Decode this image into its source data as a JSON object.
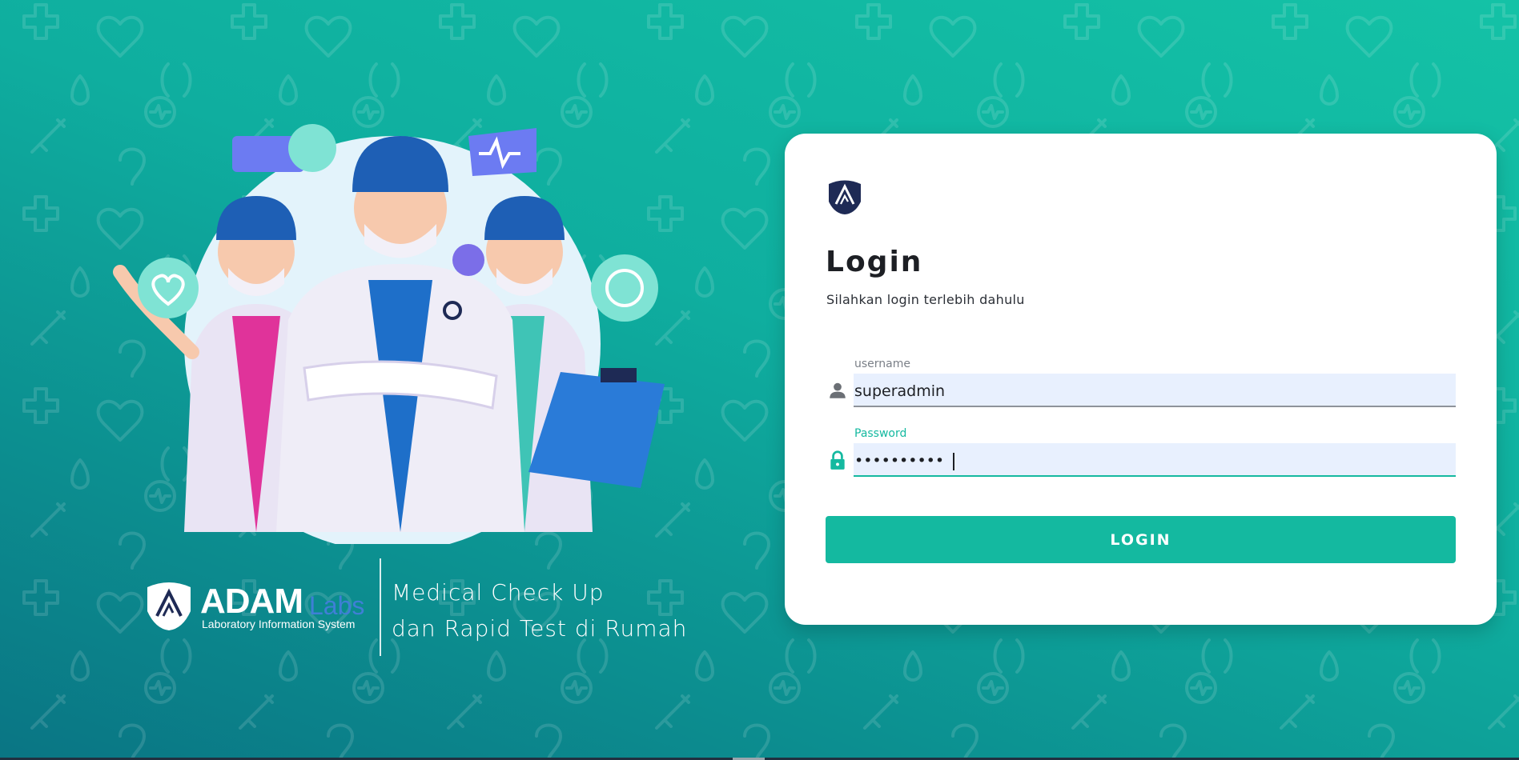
{
  "branding": {
    "name": "ADAM",
    "name_accent": "Labs",
    "subtitle": "Laboratory Information System",
    "tagline_line1": "Medical Check Up",
    "tagline_line2": "dan Rapid Test di Rumah"
  },
  "login": {
    "title": "Login",
    "subtitle": "Silahkan login terlebih dahulu",
    "username": {
      "label": "username",
      "value": "superadmin",
      "icon": "person-icon"
    },
    "password": {
      "label": "Password",
      "value": "••••••••••",
      "icon": "lock-icon"
    },
    "button_label": "LOGIN"
  },
  "colors": {
    "accent": "#14b9a0",
    "navy": "#1e2a55",
    "brand_blue": "#3f7fd6"
  }
}
